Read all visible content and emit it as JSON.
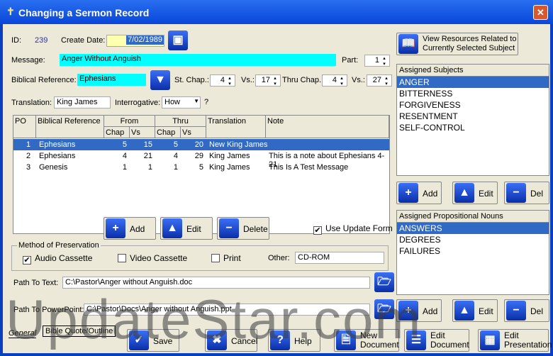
{
  "window": {
    "title": "Changing a Sermon Record",
    "close": "✕"
  },
  "form": {
    "id_label": "ID:",
    "id": "239",
    "create_date_label": "Create Date:",
    "create_date": "7/02/1989",
    "message_label": "Message:",
    "message": "Anger Without Anguish",
    "part_label": "Part:",
    "part": "1",
    "bibref_label": "Biblical Reference:",
    "bibref": "Ephesians",
    "st_chap_label": "St. Chap.:",
    "st_chap": "4",
    "vs_label": "Vs.:",
    "st_vs": "17",
    "thru_chap_label": "Thru Chap.:",
    "thru_chap": "4",
    "thru_vs_label": "Vs.:",
    "thru_vs": "27",
    "translation_label": "Translation:",
    "translation": "King James",
    "interrogative_label": "Interrogative:",
    "interrogative": "How",
    "question_mark": "?"
  },
  "grid": {
    "headers": {
      "po": "PO",
      "ref": "Biblical Reference",
      "from": "From",
      "thru": "Thru",
      "chap": "Chap",
      "vs": "Vs",
      "chap2": "Chap",
      "vs2": "Vs",
      "translation": "Translation",
      "note": "Note"
    },
    "rows": [
      {
        "po": "1",
        "ref": "Ephesians",
        "fc": "5",
        "fv": "15",
        "tc": "5",
        "tv": "20",
        "tr": "New King James",
        "note": ""
      },
      {
        "po": "2",
        "ref": "Ephesians",
        "fc": "4",
        "fv": "21",
        "tc": "4",
        "tv": "29",
        "tr": "King James",
        "note": "This is a note about Ephesians 4-21"
      },
      {
        "po": "3",
        "ref": "Genesis",
        "fc": "1",
        "fv": "1",
        "tc": "1",
        "tv": "5",
        "tr": "King James",
        "note": "This Is A Test Message"
      }
    ]
  },
  "grid_buttons": {
    "add": "Add",
    "edit": "Edit",
    "delete": "Delete",
    "use_update_form": "Use Update Form"
  },
  "preservation": {
    "title": "Method of Preservation",
    "audio": "Audio Cassette",
    "audio_checked": true,
    "video": "Video Cassette",
    "video_checked": false,
    "print": "Print",
    "print_checked": false,
    "other_label": "Other:",
    "other": "CD-ROM"
  },
  "paths": {
    "text_label": "Path To Text:",
    "text": "C:\\Pastor\\Anger without Anguish.doc",
    "ppt_label": "Path To PowerPoint:",
    "ppt": "C:\\Pastor\\Docs\\Anger without Anguish.ppt"
  },
  "tabs": [
    "General",
    "Bible Quote/Outline"
  ],
  "right": {
    "view_resources": "View Resources Related to Currently Selected Subject",
    "subjects_title": "Assigned Subjects",
    "subjects": [
      "ANGER",
      "BITTERNESS",
      "FORGIVENESS",
      "RESENTMENT",
      "SELF-CONTROL"
    ],
    "nouns_title": "Assigned Propositional Nouns",
    "nouns": [
      "ANSWERS",
      "DEGREES",
      "FAILURES"
    ],
    "add": "Add",
    "edit": "Edit",
    "del": "Del"
  },
  "bottom": {
    "save": "Save",
    "cancel": "Cancel",
    "help": "Help",
    "new_doc1": "New",
    "new_doc2": "Document",
    "edit_doc1": "Edit",
    "edit_doc2": "Document",
    "edit_pres1": "Edit",
    "edit_pres2": "Presentation"
  },
  "watermark": "UpdateStar.com"
}
